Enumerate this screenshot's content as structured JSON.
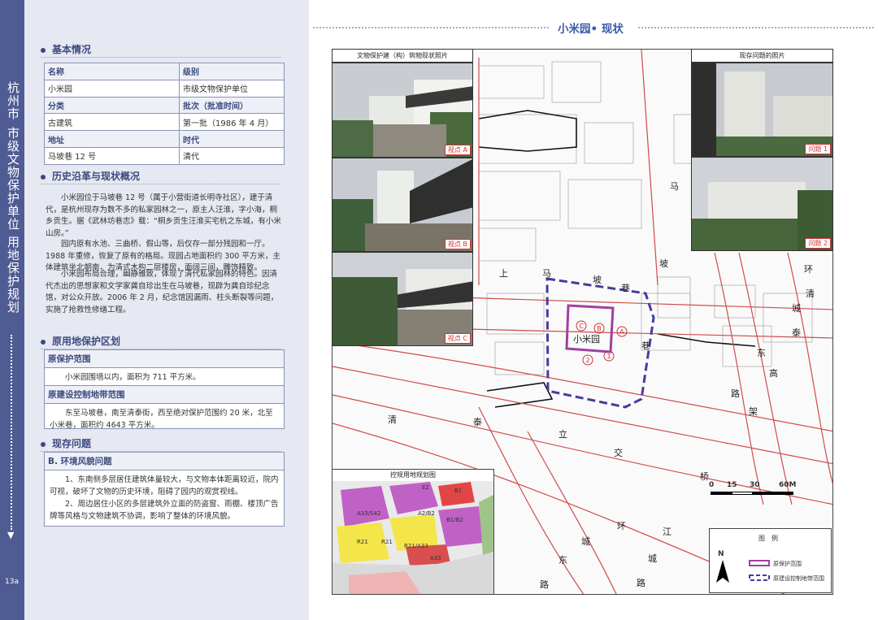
{
  "sidebar": {
    "title_city": "杭州市",
    "title_category": "市级文物保护单位",
    "title_plan": "用地保护规划",
    "page_num": "13a"
  },
  "sections": {
    "basic": "基本情况",
    "history": "历史沿革与现状概况",
    "protection": "原用地保护区划",
    "issues": "现存问题"
  },
  "basic_table": {
    "rows": [
      [
        "名称",
        "级别"
      ],
      [
        "小米园",
        "市级文物保护单位"
      ],
      [
        "分类",
        "批次（批准时间）"
      ],
      [
        "古建筑",
        "第一批（1986 年 4 月）"
      ],
      [
        "地址",
        "时代"
      ],
      [
        "马坡巷 12 号",
        "清代"
      ]
    ]
  },
  "history": {
    "p1": "小米园位于马坡巷 12 号（属于小营街道长明寺社区），建于清代，是杭州现存为数不多的私家园林之一，原主人汪淮，字小海，桐乡贡生。据《武林坊巷志》载：“桐乡贡生汪淮买宅杭之东城，有小米山房。”",
    "p2": "园内原有水池、三曲桥、假山等，后仅存一部分残园和一厅。1988 年重修，恢复了原有的格局。现园占地面积约 300 平方米，主体建筑坐北朝南，为清式木构二层楼房，面阔三间，雕饰精致。",
    "p3": "小米园布局合理，幽静雅致，体现了清代私家园林的特色。因清代杰出的思想家和文学家龚自珍出生在马坡巷，现辟为龚自珍纪念馆，对公众开放。2006 年 2 月，纪念馆因漏雨、柱头断裂等问题，实施了抢救性修缮工程。"
  },
  "protection": {
    "orig_header": "原保护范围",
    "orig_body": "小米园围墙以内，面积为 711 平方米。",
    "ctrl_header": "原建设控制地带范围",
    "ctrl_body": "东至马坡巷，南至清泰街，西至绝对保护范围约 20 米，北至小米巷，面积约 4643 平方米。"
  },
  "issues": {
    "header": "B. 环境风貌问题",
    "body1": "1、东南侧多层居住建筑体量较大，与文物本体距离较近，院内可视，破坏了文物的历史环境，阻碍了园内的观赏视线。",
    "body2": "2、周边居住小区的多层建筑外立面的防盗窗、雨棚、楼顶广告牌等风格与文物建筑不协调，影响了整体的环境风貌。"
  },
  "right": {
    "title": "小米园• 现状",
    "photos_left_header": "文物保护建（构）筑物现状照片",
    "photos_right_header": "现存问题的照片",
    "view_a": "视点 A",
    "view_b": "视点 B",
    "view_c": "视点 C",
    "problem1": "问题 1",
    "problem2": "问题 2",
    "ctrl_map_title": "控规用地规划图",
    "site_label": "小米园",
    "street_chars": [
      "马",
      "上",
      "马",
      "坡",
      "巷",
      "坡",
      "环",
      "清",
      "城",
      "泰",
      "东",
      "高",
      "路",
      "架",
      "清",
      "泰",
      "立",
      "交",
      "桥",
      "环",
      "城",
      "东",
      "路",
      "江",
      "城",
      "路",
      "巷"
    ],
    "scale_labels": [
      "0",
      "15",
      "30",
      "60M"
    ],
    "legend_title": "图　例",
    "legend_items": [
      "原保护范围",
      "原建设控制地带范围"
    ],
    "ctrl_labels": [
      "A33/S42",
      "E2",
      "R21",
      "A2/B2",
      "R21",
      "B1",
      "R21/A33",
      "B1/B2",
      "A33"
    ],
    "markers": [
      "A",
      "B",
      "C",
      "1",
      "2"
    ],
    "north": "N"
  },
  "colors": {
    "band": "#4f5b93",
    "panel": "#e6e8f2",
    "accent": "#3b4a7e",
    "title": "#3b5aa8",
    "protect": "#a040a0",
    "control": "#4a3a9c",
    "road_red": "#d24a4a"
  }
}
